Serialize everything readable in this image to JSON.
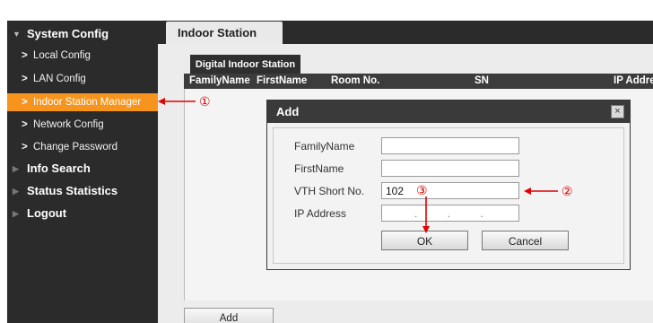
{
  "sidebar": {
    "system_config": "System Config",
    "items": [
      {
        "label": "Local Config"
      },
      {
        "label": "LAN Config"
      },
      {
        "label": "Indoor Station Manager"
      },
      {
        "label": "Network Config"
      },
      {
        "label": "Change Password"
      }
    ],
    "info_search": "Info Search",
    "status_statistics": "Status Statistics",
    "logout": "Logout",
    "active_item": "Indoor Station Manager",
    "active_color": "#f7941d"
  },
  "main_tab": "Indoor Station",
  "sub_tab": "Digital Indoor Station",
  "table": {
    "columns": [
      "FamilyName",
      "FirstName",
      "Room No.",
      "SN",
      "IP Address"
    ]
  },
  "add_button": "Add",
  "dialog": {
    "title": "Add",
    "close": "×",
    "fields": {
      "family_name": {
        "label": "FamilyName",
        "value": ""
      },
      "first_name": {
        "label": "FirstName",
        "value": ""
      },
      "vth_short_no": {
        "label": "VTH Short No.",
        "value": "102"
      },
      "ip_address": {
        "label": "IP Address",
        "value": ". . ."
      }
    },
    "ok": "OK",
    "cancel": "Cancel"
  },
  "annotations": {
    "one": "①",
    "two": "②",
    "three": "③",
    "color": "#e00000"
  }
}
